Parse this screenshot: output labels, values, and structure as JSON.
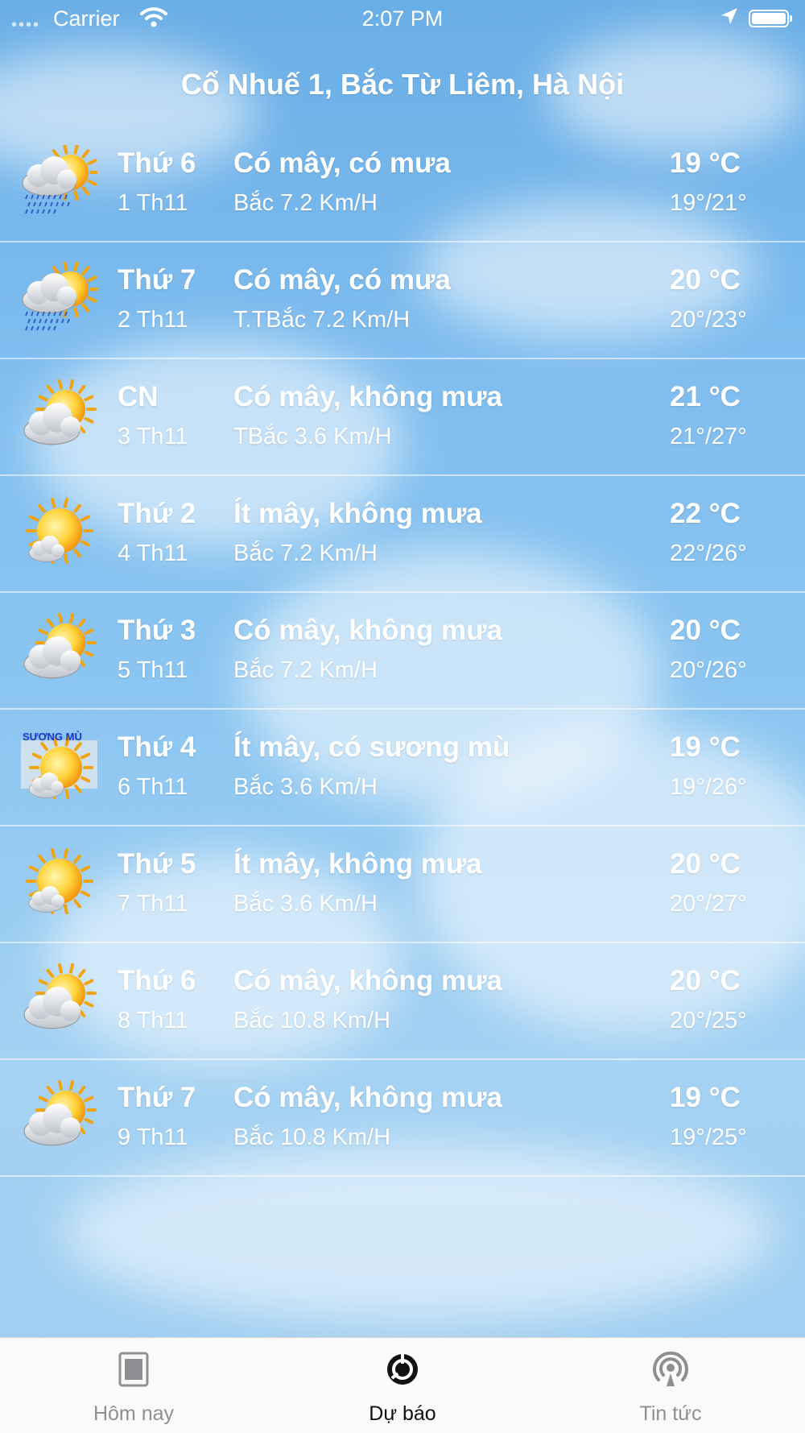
{
  "status_bar": {
    "carrier": "Carrier",
    "time": "2:07 PM"
  },
  "location": "Cổ Nhuế 1, Bắc Từ Liêm, Hà Nội",
  "forecast": [
    {
      "day": "Thứ 6",
      "date": "1 Th11",
      "condition": "Có mây, có mưa",
      "wind": "Bắc 7.2 Km/H",
      "temp": "19 °C",
      "range": "19°/21°",
      "icon": "rain-cloud-sun-icon"
    },
    {
      "day": "Thứ 7",
      "date": "2 Th11",
      "condition": "Có mây, có mưa",
      "wind": "T.TBắc 7.2 Km/H",
      "temp": "20 °C",
      "range": "20°/23°",
      "icon": "rain-cloud-sun-icon"
    },
    {
      "day": "CN",
      "date": "3 Th11",
      "condition": "Có mây, không mưa",
      "wind": "TBắc 3.6 Km/H",
      "temp": "21 °C",
      "range": "21°/27°",
      "icon": "cloud-sun-icon"
    },
    {
      "day": "Thứ 2",
      "date": "4 Th11",
      "condition": "Ít mây, không mưa",
      "wind": "Bắc 7.2 Km/H",
      "temp": "22 °C",
      "range": "22°/26°",
      "icon": "sun-small-cloud-icon"
    },
    {
      "day": "Thứ 3",
      "date": "5 Th11",
      "condition": "Có mây, không mưa",
      "wind": "Bắc 7.2 Km/H",
      "temp": "20 °C",
      "range": "20°/26°",
      "icon": "cloud-sun-icon"
    },
    {
      "day": "Thứ 4",
      "date": "6 Th11",
      "condition": "Ít mây, có sương mù",
      "wind": "Bắc 3.6 Km/H",
      "temp": "19 °C",
      "range": "19°/26°",
      "icon": "fog-sun-icon",
      "icon_text": "SƯƠNG MÙ"
    },
    {
      "day": "Thứ 5",
      "date": "7 Th11",
      "condition": "Ít mây, không mưa",
      "wind": "Bắc 3.6 Km/H",
      "temp": "20 °C",
      "range": "20°/27°",
      "icon": "sun-small-cloud-icon"
    },
    {
      "day": "Thứ 6",
      "date": "8 Th11",
      "condition": "Có mây, không mưa",
      "wind": "Bắc 10.8 Km/H",
      "temp": "20 °C",
      "range": "20°/25°",
      "icon": "cloud-sun-icon"
    },
    {
      "day": "Thứ 7",
      "date": "9 Th11",
      "condition": "Có mây, không mưa",
      "wind": "Bắc 10.8 Km/H",
      "temp": "19 °C",
      "range": "19°/25°",
      "icon": "cloud-sun-icon"
    }
  ],
  "tabs": [
    {
      "label": "Hôm nay",
      "icon": "document-icon",
      "active": false
    },
    {
      "label": "Dự báo",
      "icon": "forecast-icon",
      "active": true
    },
    {
      "label": "Tin tức",
      "icon": "broadcast-icon",
      "active": false
    }
  ],
  "colors": {
    "sky_top": "#6aaee6",
    "sky_bottom": "#9fcdf1",
    "tab_active": "#111111",
    "tab_inactive": "#8e8e93",
    "fog_label": "#1a3cc8"
  }
}
